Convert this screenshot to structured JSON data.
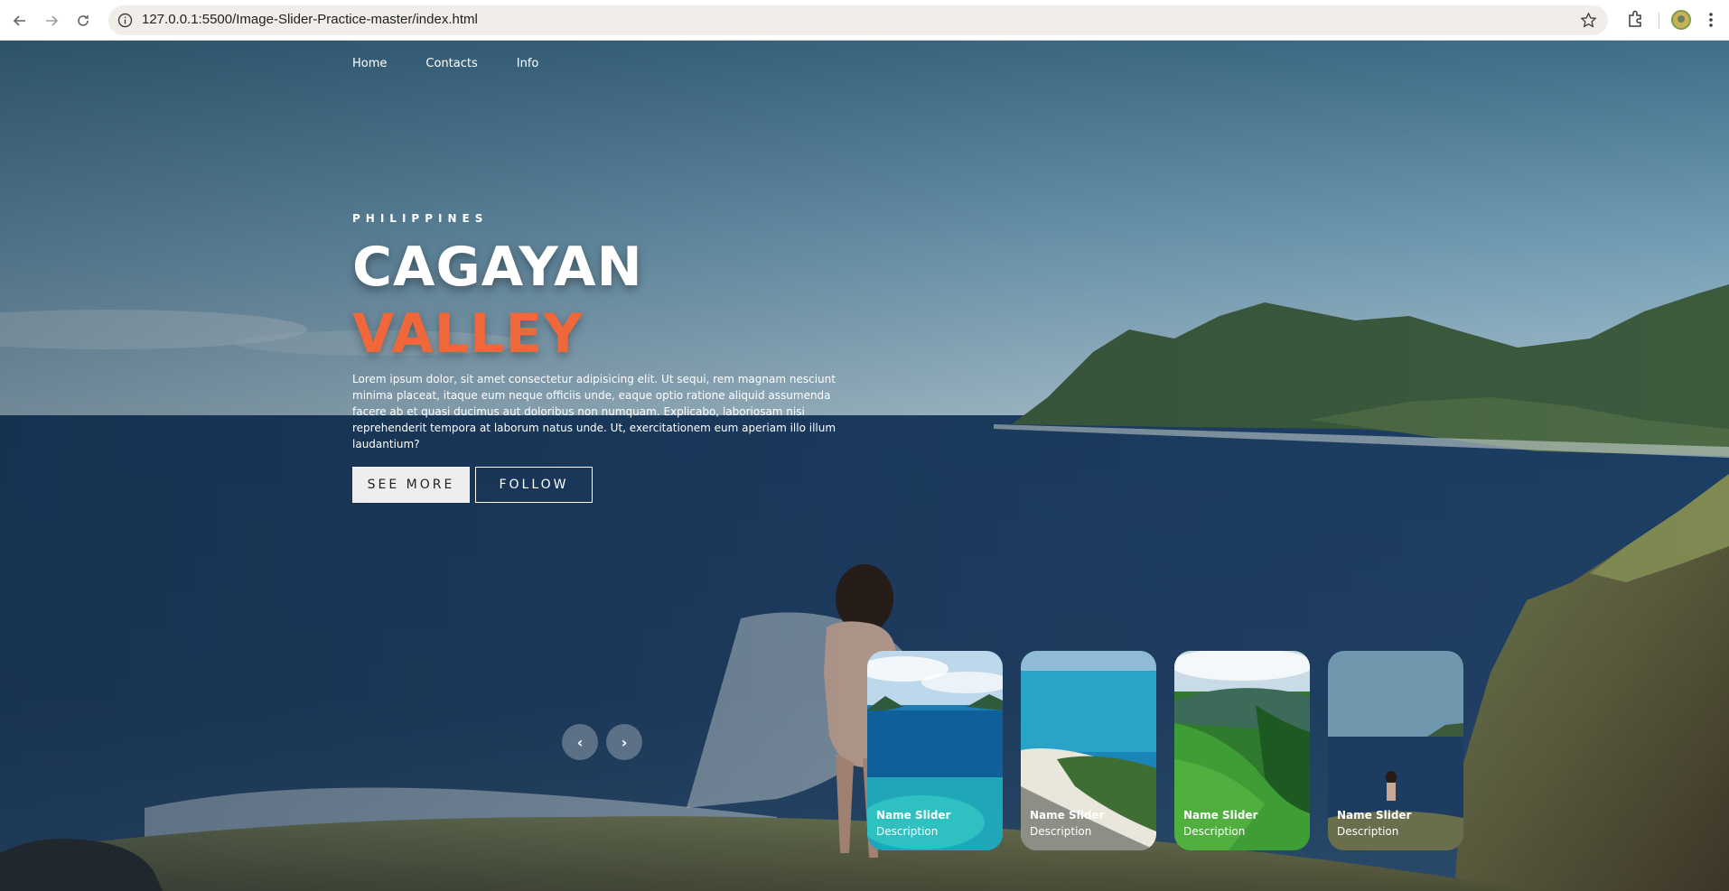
{
  "browser": {
    "url": "127.0.0.1:5500/Image-Slider-Practice-master/index.html",
    "icons": [
      "back-icon",
      "forward-icon",
      "reload-icon",
      "site-info-icon",
      "bookmark-star-icon",
      "extensions-icon",
      "profile-avatar",
      "kebab-menu-icon"
    ]
  },
  "nav": {
    "items": [
      "Home",
      "Contacts",
      "Info"
    ]
  },
  "hero": {
    "kicker": "PHILIPPINES",
    "title": "CAGAYAN",
    "topic": "VALLEY",
    "description": "Lorem ipsum dolor, sit amet consectetur adipisicing elit. Ut sequi, rem magnam nesciunt minima placeat, itaque eum neque officiis unde, eaque optio ratione aliquid assumenda facere ab et quasi ducimus aut doloribus non numquam. Explicabo, laboriosam nisi reprehenderit tempora at laborum natus unde. Ut, exercitationem eum aperiam illo illum laudantium?",
    "see_more": "SEE MORE",
    "follow": "FOLLOW"
  },
  "arrows": {
    "prev": "‹",
    "next": "›"
  },
  "thumbnails": [
    {
      "name": "Name Slider",
      "description": "Description"
    },
    {
      "name": "Name Slider",
      "description": "Description"
    },
    {
      "name": "Name Slider",
      "description": "Description"
    },
    {
      "name": "Name Slider",
      "description": "Description"
    }
  ],
  "colors": {
    "accent": "#f0683a",
    "sky": "#5d8aa6",
    "sea": "#1f3f66"
  }
}
